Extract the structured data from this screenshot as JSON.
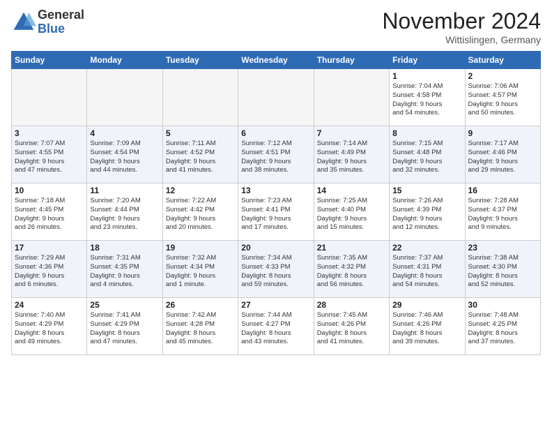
{
  "header": {
    "logo_general": "General",
    "logo_blue": "Blue",
    "month_title": "November 2024",
    "location": "Wittislingen, Germany"
  },
  "days_of_week": [
    "Sunday",
    "Monday",
    "Tuesday",
    "Wednesday",
    "Thursday",
    "Friday",
    "Saturday"
  ],
  "weeks": [
    [
      {
        "day": "",
        "info": "",
        "empty": true
      },
      {
        "day": "",
        "info": "",
        "empty": true
      },
      {
        "day": "",
        "info": "",
        "empty": true
      },
      {
        "day": "",
        "info": "",
        "empty": true
      },
      {
        "day": "",
        "info": "",
        "empty": true
      },
      {
        "day": "1",
        "info": "Sunrise: 7:04 AM\nSunset: 4:58 PM\nDaylight: 9 hours\nand 54 minutes."
      },
      {
        "day": "2",
        "info": "Sunrise: 7:06 AM\nSunset: 4:57 PM\nDaylight: 9 hours\nand 50 minutes."
      }
    ],
    [
      {
        "day": "3",
        "info": "Sunrise: 7:07 AM\nSunset: 4:55 PM\nDaylight: 9 hours\nand 47 minutes."
      },
      {
        "day": "4",
        "info": "Sunrise: 7:09 AM\nSunset: 4:54 PM\nDaylight: 9 hours\nand 44 minutes."
      },
      {
        "day": "5",
        "info": "Sunrise: 7:11 AM\nSunset: 4:52 PM\nDaylight: 9 hours\nand 41 minutes."
      },
      {
        "day": "6",
        "info": "Sunrise: 7:12 AM\nSunset: 4:51 PM\nDaylight: 9 hours\nand 38 minutes."
      },
      {
        "day": "7",
        "info": "Sunrise: 7:14 AM\nSunset: 4:49 PM\nDaylight: 9 hours\nand 35 minutes."
      },
      {
        "day": "8",
        "info": "Sunrise: 7:15 AM\nSunset: 4:48 PM\nDaylight: 9 hours\nand 32 minutes."
      },
      {
        "day": "9",
        "info": "Sunrise: 7:17 AM\nSunset: 4:46 PM\nDaylight: 9 hours\nand 29 minutes."
      }
    ],
    [
      {
        "day": "10",
        "info": "Sunrise: 7:18 AM\nSunset: 4:45 PM\nDaylight: 9 hours\nand 26 minutes."
      },
      {
        "day": "11",
        "info": "Sunrise: 7:20 AM\nSunset: 4:44 PM\nDaylight: 9 hours\nand 23 minutes."
      },
      {
        "day": "12",
        "info": "Sunrise: 7:22 AM\nSunset: 4:42 PM\nDaylight: 9 hours\nand 20 minutes."
      },
      {
        "day": "13",
        "info": "Sunrise: 7:23 AM\nSunset: 4:41 PM\nDaylight: 9 hours\nand 17 minutes."
      },
      {
        "day": "14",
        "info": "Sunrise: 7:25 AM\nSunset: 4:40 PM\nDaylight: 9 hours\nand 15 minutes."
      },
      {
        "day": "15",
        "info": "Sunrise: 7:26 AM\nSunset: 4:39 PM\nDaylight: 9 hours\nand 12 minutes."
      },
      {
        "day": "16",
        "info": "Sunrise: 7:28 AM\nSunset: 4:37 PM\nDaylight: 9 hours\nand 9 minutes."
      }
    ],
    [
      {
        "day": "17",
        "info": "Sunrise: 7:29 AM\nSunset: 4:36 PM\nDaylight: 9 hours\nand 6 minutes."
      },
      {
        "day": "18",
        "info": "Sunrise: 7:31 AM\nSunset: 4:35 PM\nDaylight: 9 hours\nand 4 minutes."
      },
      {
        "day": "19",
        "info": "Sunrise: 7:32 AM\nSunset: 4:34 PM\nDaylight: 9 hours\nand 1 minute."
      },
      {
        "day": "20",
        "info": "Sunrise: 7:34 AM\nSunset: 4:33 PM\nDaylight: 8 hours\nand 59 minutes."
      },
      {
        "day": "21",
        "info": "Sunrise: 7:35 AM\nSunset: 4:32 PM\nDaylight: 8 hours\nand 56 minutes."
      },
      {
        "day": "22",
        "info": "Sunrise: 7:37 AM\nSunset: 4:31 PM\nDaylight: 8 hours\nand 54 minutes."
      },
      {
        "day": "23",
        "info": "Sunrise: 7:38 AM\nSunset: 4:30 PM\nDaylight: 8 hours\nand 52 minutes."
      }
    ],
    [
      {
        "day": "24",
        "info": "Sunrise: 7:40 AM\nSunset: 4:29 PM\nDaylight: 8 hours\nand 49 minutes."
      },
      {
        "day": "25",
        "info": "Sunrise: 7:41 AM\nSunset: 4:29 PM\nDaylight: 8 hours\nand 47 minutes."
      },
      {
        "day": "26",
        "info": "Sunrise: 7:42 AM\nSunset: 4:28 PM\nDaylight: 8 hours\nand 45 minutes."
      },
      {
        "day": "27",
        "info": "Sunrise: 7:44 AM\nSunset: 4:27 PM\nDaylight: 8 hours\nand 43 minutes."
      },
      {
        "day": "28",
        "info": "Sunrise: 7:45 AM\nSunset: 4:26 PM\nDaylight: 8 hours\nand 41 minutes."
      },
      {
        "day": "29",
        "info": "Sunrise: 7:46 AM\nSunset: 4:26 PM\nDaylight: 8 hours\nand 39 minutes."
      },
      {
        "day": "30",
        "info": "Sunrise: 7:48 AM\nSunset: 4:25 PM\nDaylight: 8 hours\nand 37 minutes."
      }
    ]
  ]
}
